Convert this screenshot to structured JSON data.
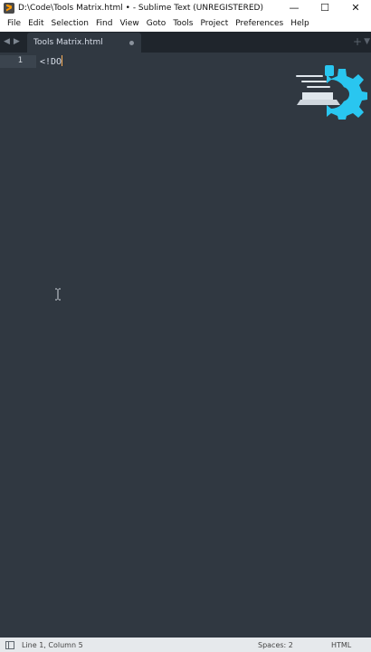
{
  "window": {
    "title": "D:\\Code\\Tools Matrix.html • - Sublime Text (UNREGISTERED)",
    "minimize": "—",
    "maximize": "☐",
    "close": "✕"
  },
  "menu": {
    "items": [
      "File",
      "Edit",
      "Selection",
      "Find",
      "View",
      "Goto",
      "Tools",
      "Project",
      "Preferences",
      "Help"
    ]
  },
  "tabs": {
    "nav_back": "◀",
    "nav_forward": "▶",
    "active_label": "Tools Matrix.html",
    "new_tab": "+",
    "dropdown": "▼"
  },
  "editor": {
    "line_number": "1",
    "code_text": "<!DO"
  },
  "status": {
    "position": "Line 1, Column 5",
    "indent": "Spaces: 2",
    "syntax": "HTML"
  },
  "colors": {
    "editor_bg": "#303841",
    "tabbar_bg": "#1f252c",
    "caret": "#f9ae58",
    "logo_accent": "#29c6f0"
  }
}
